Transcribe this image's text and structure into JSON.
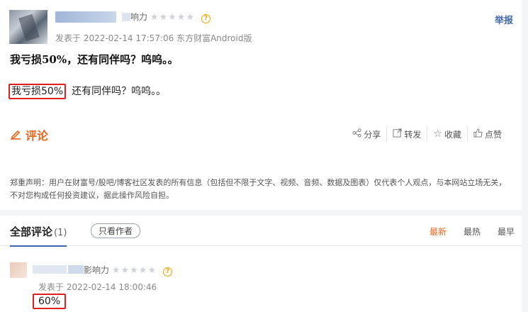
{
  "post": {
    "influence_label": "响力",
    "stars": "★★★★★",
    "help_icon": "?",
    "meta": "发表于 2022-02-14 17:57:06 东方财富Android版",
    "report_label": "举报",
    "title": "我亏损50%，还有同伴吗？呜呜。。",
    "body_highlight": "我亏损50%",
    "body_rest": "还有同伴吗？呜呜。。",
    "comment_label": "评论",
    "actions": [
      {
        "icon": "share-icon",
        "label": "分享"
      },
      {
        "icon": "repost-icon",
        "label": "转发"
      },
      {
        "icon": "star-icon",
        "label": "收藏"
      },
      {
        "icon": "thumb-up-icon",
        "label": "点赞"
      }
    ],
    "disclaimer": "郑重声明：用户在财富号/股吧/博客社区发表的所有信息（包括但不限于文字、视频、音频、数据及图表）仅代表个人观点，与本网站立场无关，不对您构成任何投资建议，据此操作风险自担。"
  },
  "comments": {
    "all_label": "全部评论",
    "count": "(1)",
    "author_only": "只看作者",
    "sort": [
      "最新",
      "最热",
      "最早"
    ],
    "active_sort": "最新",
    "items": [
      {
        "influence_label": "影响力",
        "stars": "★★★★★",
        "help_icon": "?",
        "meta": "发表于 2022-02-14 18:00:46",
        "text": "60%"
      }
    ]
  },
  "colors": {
    "accent": "#e8651e",
    "link": "#3f66b3",
    "highlight_box": "#e0201e"
  }
}
